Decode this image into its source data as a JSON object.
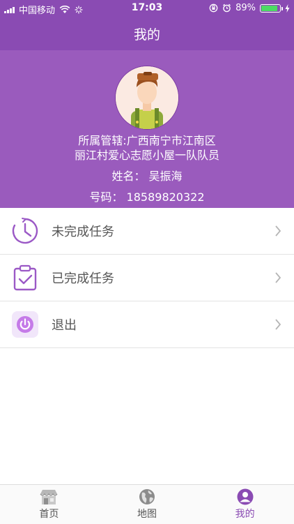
{
  "status_bar": {
    "carrier": "中国移动",
    "time": "17:03",
    "battery": "89%",
    "battery_level": 0.89
  },
  "header": {
    "title": "我的"
  },
  "profile": {
    "affiliation_line1": "所属管辖:广西南宁市江南区",
    "affiliation_line2": "丽江村爱心志愿小屋一队队员",
    "name": "姓名：  吴振海",
    "phone": "号码：  18589820322"
  },
  "menu": {
    "items": [
      {
        "label": "未完成任务",
        "icon": "clock-history-icon"
      },
      {
        "label": "已完成任务",
        "icon": "clipboard-check-icon"
      },
      {
        "label": "退出",
        "icon": "power-icon"
      }
    ]
  },
  "tabbar": {
    "tabs": [
      {
        "label": "首页",
        "icon": "store-icon"
      },
      {
        "label": "地图",
        "icon": "globe-icon"
      },
      {
        "label": "我的",
        "icon": "user-icon"
      }
    ],
    "active_index": 2
  },
  "colors": {
    "primary": "#8a4bb3",
    "profile_bg": "#9a5bbd",
    "icon_purple": "#9b59c6",
    "exit_icon_bg": "#f1e6fa",
    "exit_icon": "#c57be8"
  }
}
